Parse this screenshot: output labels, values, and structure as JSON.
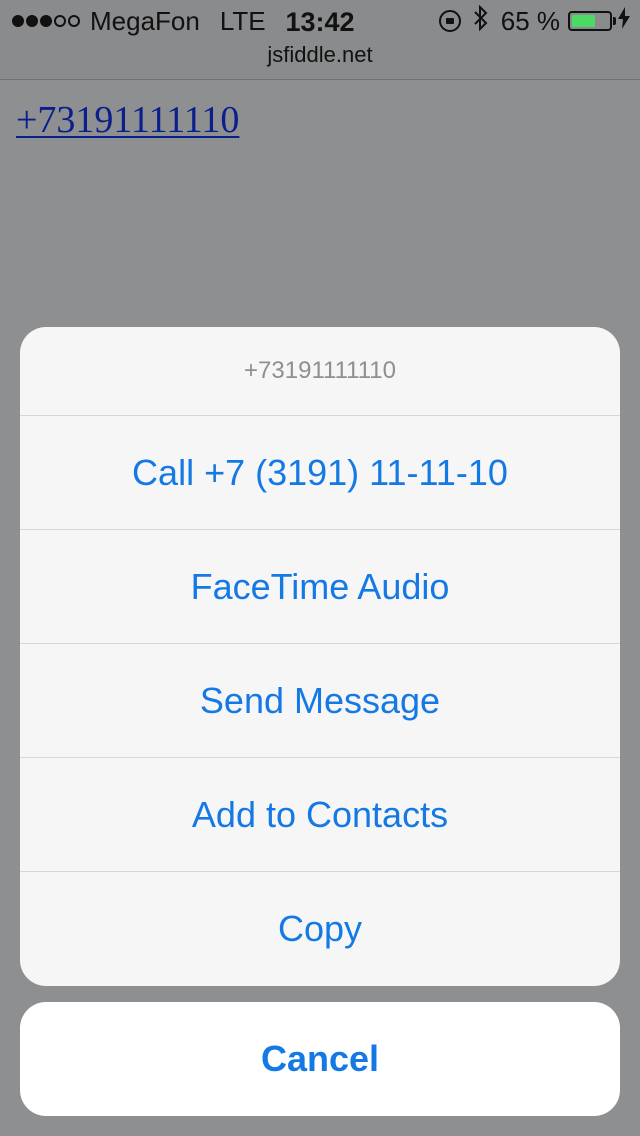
{
  "status_bar": {
    "carrier": "MegaFon",
    "network": "LTE",
    "time": "13:42",
    "battery_percent": "65 %",
    "battery_level": 0.65,
    "url": "jsfiddle.net",
    "icons": [
      "signal-dots",
      "rotation-lock-icon",
      "bluetooth-icon",
      "battery-icon",
      "charging-icon"
    ]
  },
  "page": {
    "phone_link": "+73191111110"
  },
  "action_sheet": {
    "title": "+73191111110",
    "actions": [
      {
        "label": "Call +7 (3191) 11-11-10"
      },
      {
        "label": "FaceTime Audio"
      },
      {
        "label": "Send Message"
      },
      {
        "label": "Add to Contacts"
      },
      {
        "label": "Copy"
      }
    ],
    "cancel_label": "Cancel"
  },
  "colors": {
    "accent": "#1479e4",
    "dim_background": "#8e8f91",
    "battery_green": "#4cd964",
    "link": "#0b1f8c"
  }
}
